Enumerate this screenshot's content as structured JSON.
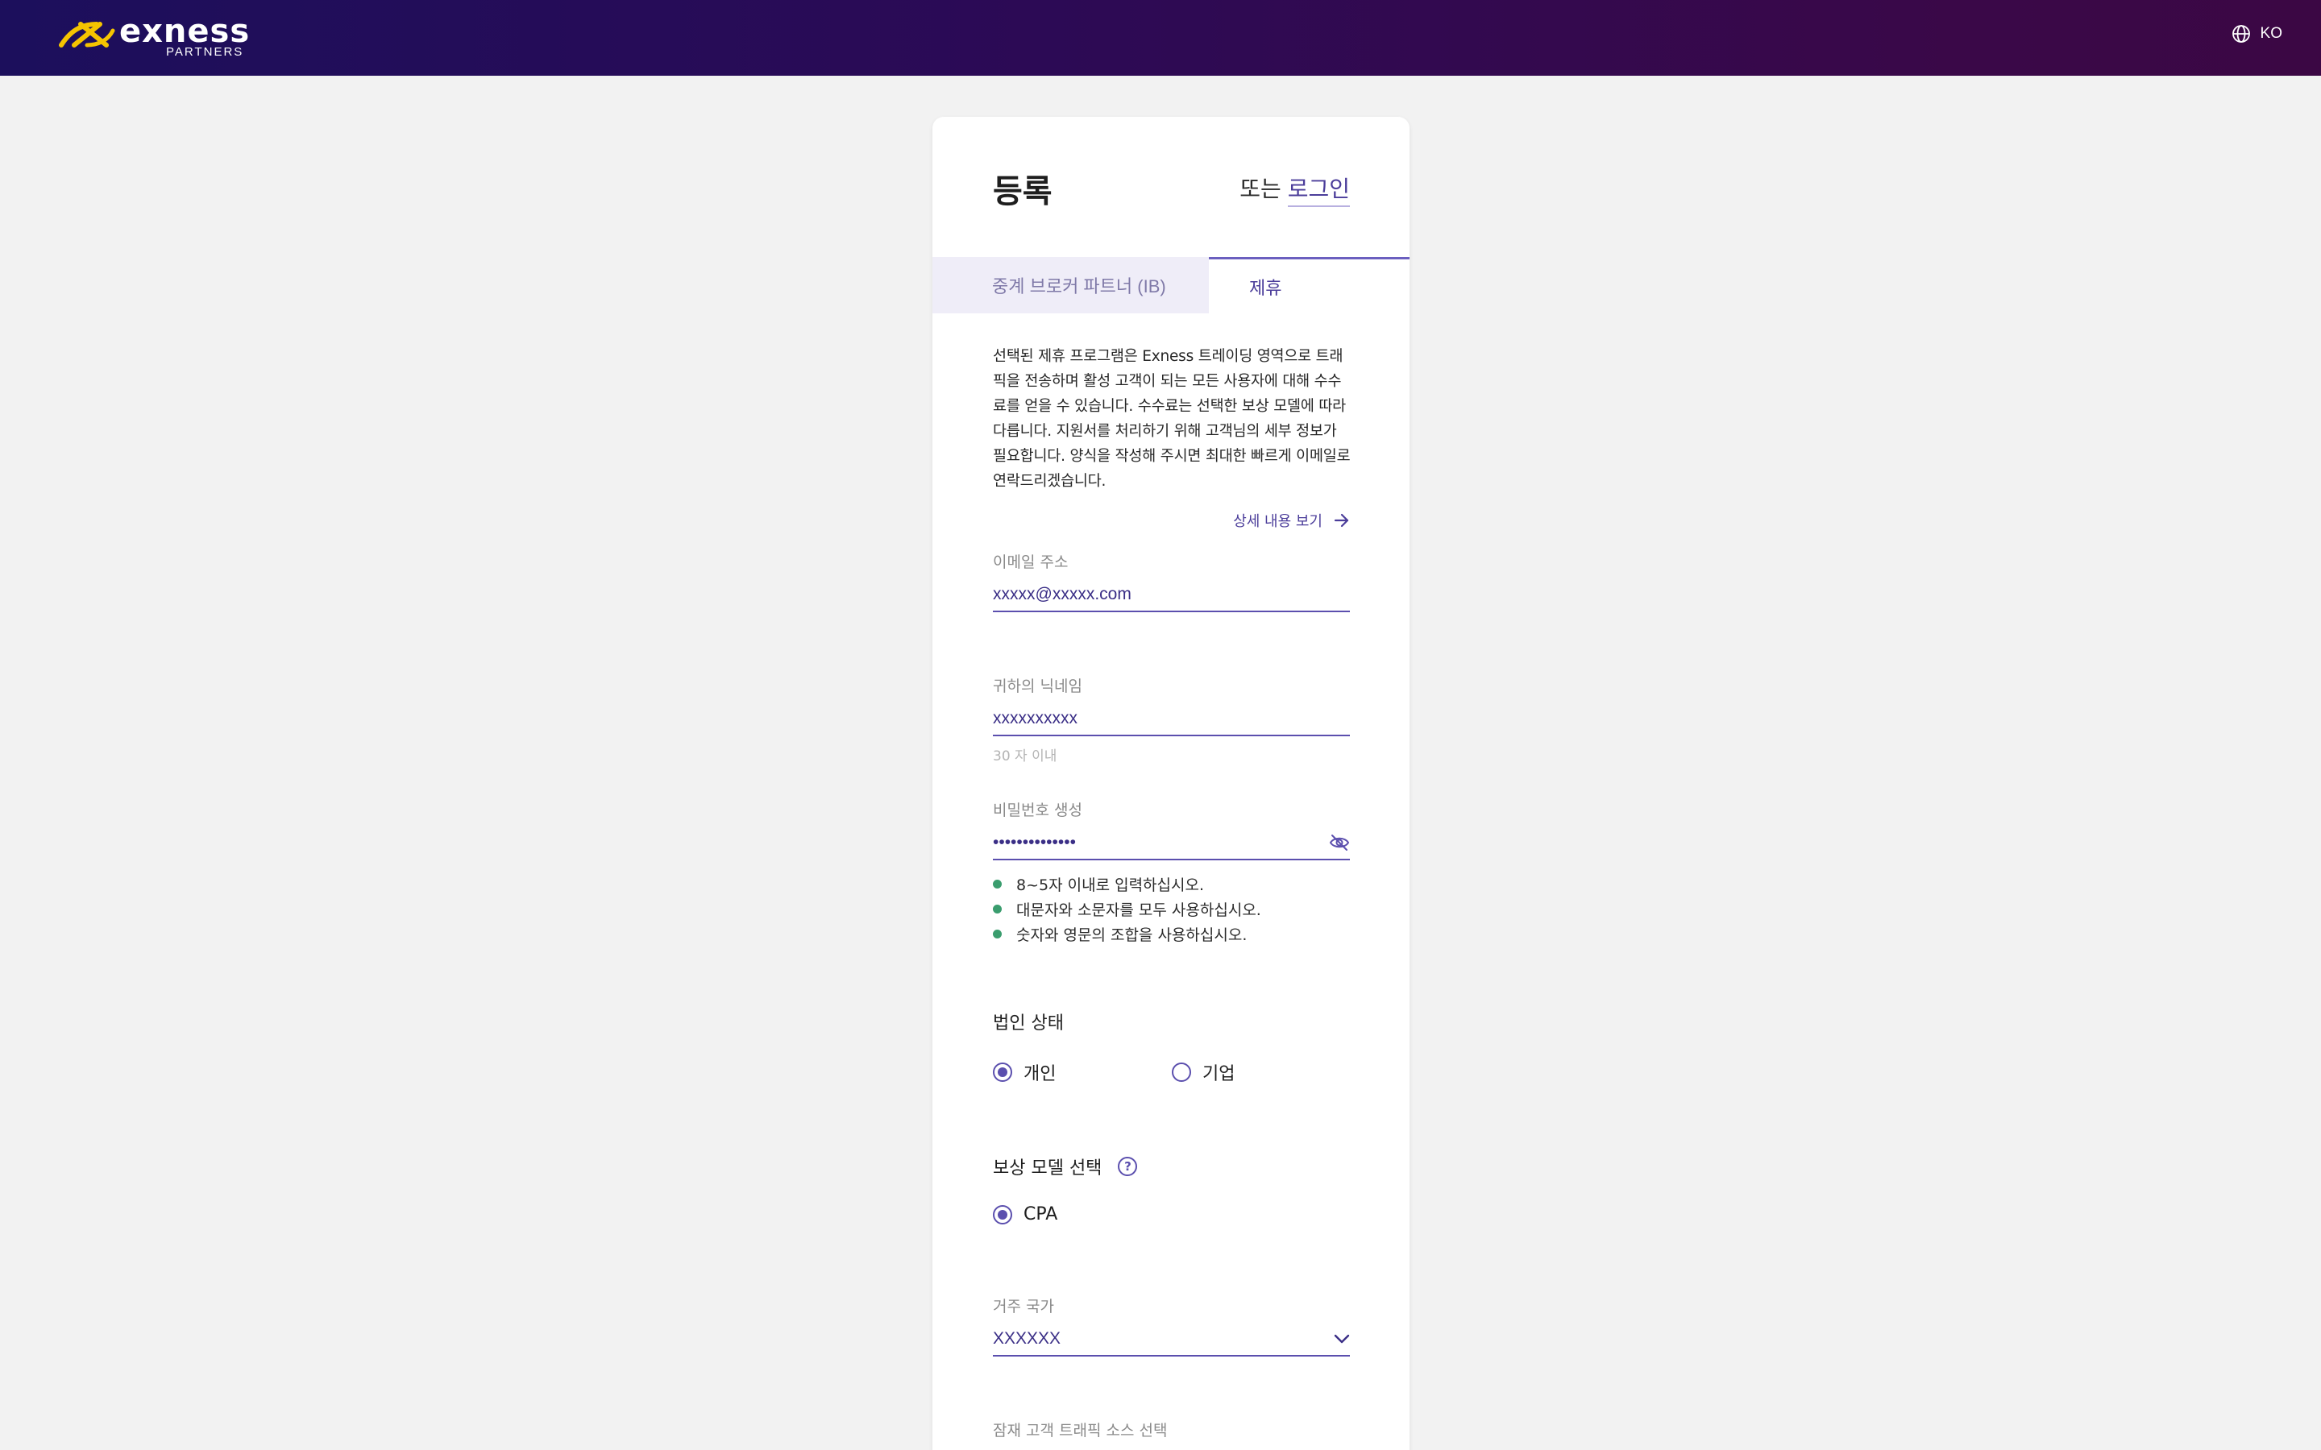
{
  "header": {
    "brand": "exness",
    "brand_sub": "PARTNERS",
    "language": "KO",
    "colors": {
      "gradient_start": "#1c0f5c",
      "gradient_end": "#3b0744"
    }
  },
  "form": {
    "title": "등록",
    "or_text": "또는",
    "login_link": "로그인",
    "tabs": [
      {
        "label": "중계 브로커 파트너 (IB)",
        "active": false
      },
      {
        "label": "제휴",
        "active": true
      }
    ],
    "description": "선택된 제휴 프로그램은 Exness 트레이딩 영역으로 트래픽을 전송하며 활성 고객이 되는 모든 사용자에 대해 수수료를 얻을 수 있습니다. 수수료는 선택한 보상 모델에 따라 다릅니다. 지원서를 처리하기 위해 고객님의 세부 정보가 필요합니다. 양식을 작성해 주시면 최대한 빠르게 이메일로 연락드리겠습니다.",
    "more_link": "상세 내용 보기",
    "email": {
      "label": "이메일 주소",
      "value": "xxxxx@xxxxx.com"
    },
    "nickname": {
      "label": "귀하의 닉네임",
      "value": "xxxxxxxxxx",
      "hint": "30 자 이내"
    },
    "password": {
      "label": "비밀번호 생성",
      "value": "••••••••••••••",
      "rules": [
        "8~5자 이내로 입력하십시오.",
        "대문자와 소문자를 모두 사용하십시오.",
        "숫자와 영문의 조합을 사용하십시오."
      ]
    },
    "legal_status": {
      "title": "법인 상태",
      "options": [
        {
          "label": "개인",
          "checked": true
        },
        {
          "label": "기업",
          "checked": false
        }
      ]
    },
    "reward_model": {
      "title": "보상 모델 선택",
      "help": "?",
      "options": [
        {
          "label": "CPA",
          "checked": true
        }
      ]
    },
    "country": {
      "label": "거주 국가",
      "value": "XXXXXX"
    },
    "traffic_source": {
      "label": "잠재 고객 트래픽 소스 선택"
    },
    "accent_color": "#5b4fae",
    "rule_dot_color": "#3a9d6e"
  }
}
